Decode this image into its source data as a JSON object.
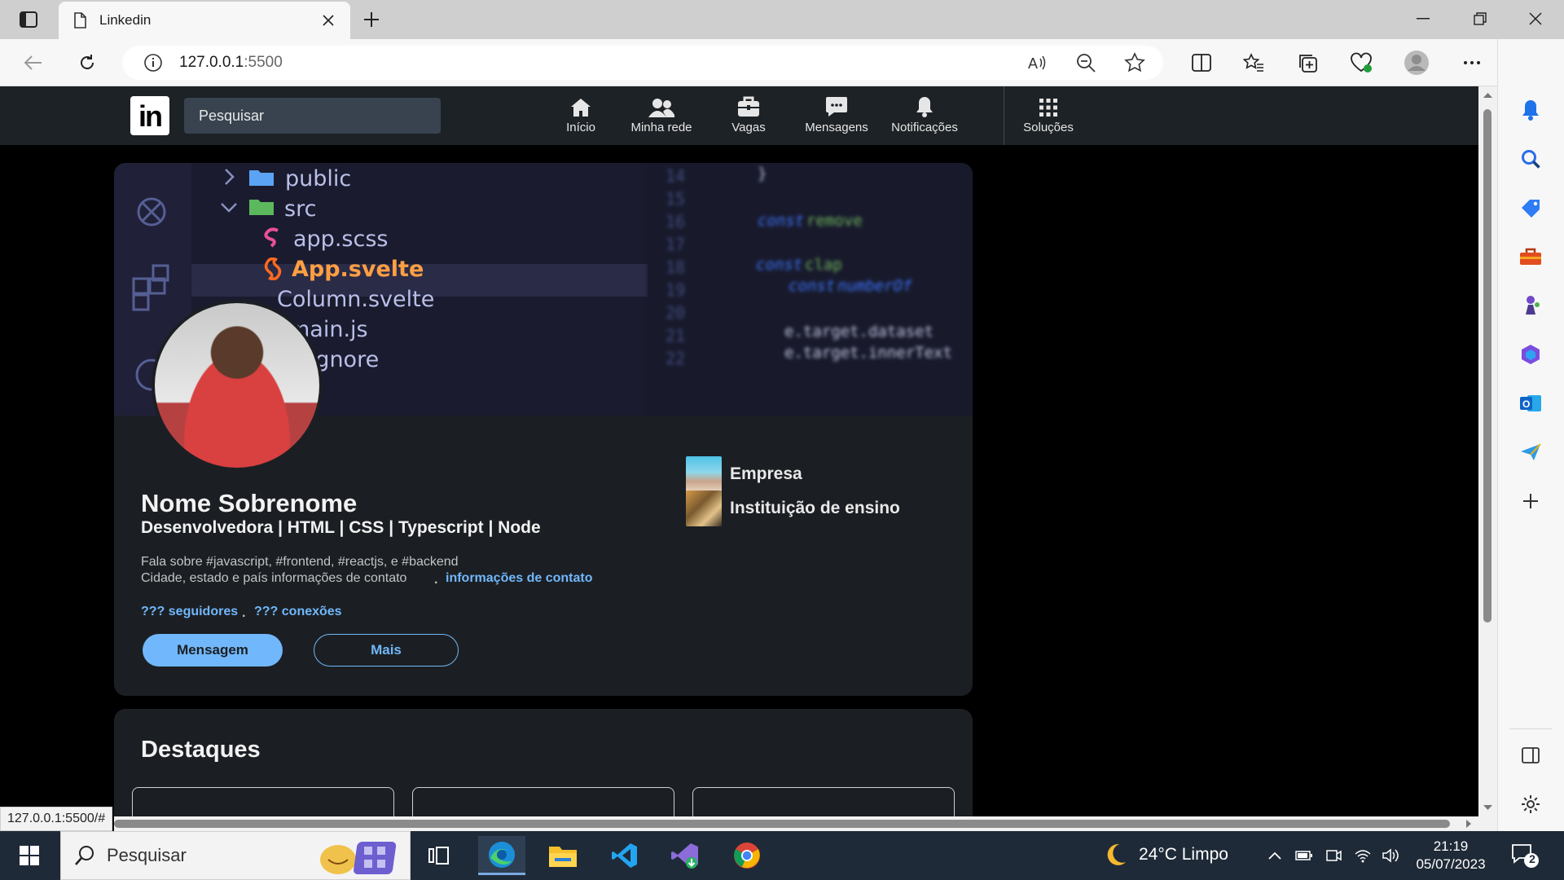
{
  "browser": {
    "tab_title": "Linkedin",
    "url_host": "127.0.0.1",
    "url_port": ":5500",
    "status_url": "127.0.0.1:5500/#"
  },
  "linkedin": {
    "logo_text": "in",
    "search_placeholder": "Pesquisar",
    "nav": [
      {
        "label": "Início",
        "icon": "home-icon"
      },
      {
        "label": "Minha rede",
        "icon": "network-icon"
      },
      {
        "label": "Vagas",
        "icon": "briefcase-icon"
      },
      {
        "label": "Mensagens",
        "icon": "message-icon"
      },
      {
        "label": "Notificações",
        "icon": "bell-icon"
      },
      {
        "label": "Soluções",
        "icon": "grid-icon"
      }
    ]
  },
  "banner": {
    "tree": [
      "public",
      "src",
      "app.scss",
      "App.svelte",
      "Column.svelte",
      "main.js",
      ".gitignore"
    ],
    "line_numbers": [
      "14",
      "15",
      "16",
      "17",
      "18",
      "19",
      "20",
      "21",
      "22"
    ],
    "code": [
      "const",
      "remove",
      "const",
      "clap",
      "const",
      "numberOf",
      "e.target.dataset",
      "e.target.innerText"
    ]
  },
  "profile": {
    "name": "Nome Sobrenome",
    "headline": "Desenvolvedora | HTML | CSS | Typescript | Node",
    "about": "Fala sobre #javascript, #frontend, #reactjs, e #backend",
    "location": "Cidade, estado e país informações de contato",
    "separator": ".",
    "contact_link": "informações de contato",
    "followers": "??? seguidores",
    "connections": "??? conexões",
    "message_button": "Mensagem",
    "more_button": "Mais",
    "company": "Empresa",
    "school": "Instituição de ensino"
  },
  "highlights": {
    "title": "Destaques"
  },
  "taskbar": {
    "search_placeholder": "Pesquisar",
    "weather": "24°C  Limpo",
    "time": "21:19",
    "date": "05/07/2023",
    "notification_count": "2"
  },
  "colors": {
    "linkedin_blue": "#71b7fb",
    "card_bg": "#1b1f23",
    "header_bg": "#1d2226"
  }
}
